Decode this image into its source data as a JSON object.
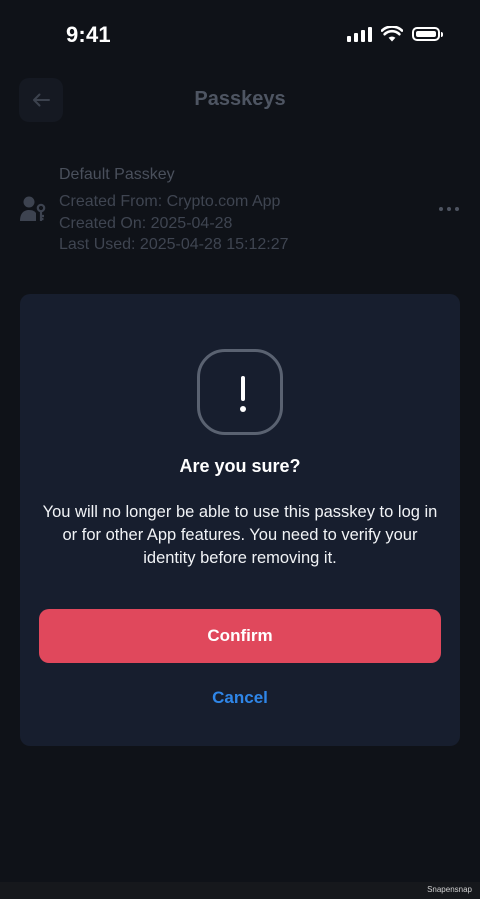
{
  "status_bar": {
    "time": "9:41"
  },
  "header": {
    "title": "Passkeys"
  },
  "passkey": {
    "name": "Default Passkey",
    "created_from": "Created From: Crypto.com App",
    "created_on": "Created On: 2025-04-28",
    "last_used": "Last Used: 2025-04-28 15:12:27"
  },
  "dialog": {
    "icon": "exclamation-icon",
    "title": "Are you sure?",
    "message": "You will no longer be able to use this passkey to log in or for other App features. You need to verify your identity before removing it.",
    "confirm_label": "Confirm",
    "cancel_label": "Cancel"
  },
  "colors": {
    "accent_danger": "#e0485c",
    "accent_link": "#2f86e8",
    "dialog_bg": "#171e2e"
  },
  "footer": {
    "watermark": "Snapensnap"
  }
}
